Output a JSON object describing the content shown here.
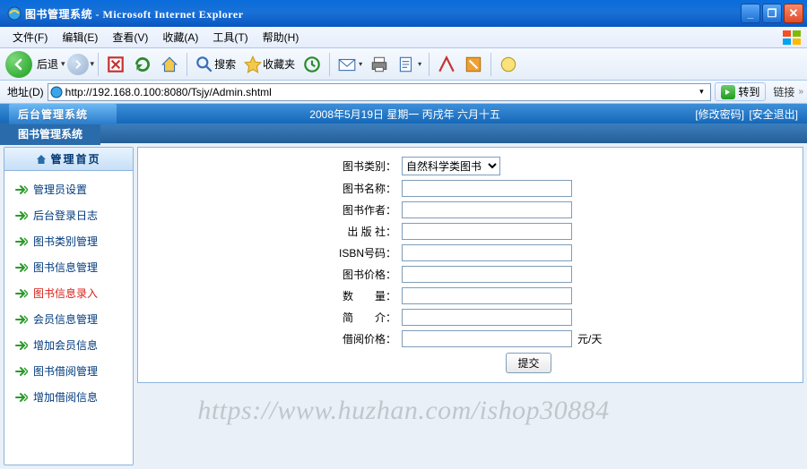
{
  "window": {
    "title": "图书管理系统 - Microsoft Internet Explorer"
  },
  "menu": {
    "items": [
      "文件(F)",
      "编辑(E)",
      "查看(V)",
      "收藏(A)",
      "工具(T)",
      "帮助(H)"
    ]
  },
  "toolbar": {
    "back": "后退",
    "search": "搜索",
    "favorites": "收藏夹"
  },
  "address": {
    "label": "地址(D)",
    "url": "http://192.168.0.100:8080/Tsjy/Admin.shtml",
    "go": "转到",
    "links": "链接"
  },
  "app": {
    "brand": "后台管理系统",
    "date": "2008年5月19日 星期一 丙戌年 六月十五",
    "change_pw": "[修改密码]",
    "logout": "[安全退出]",
    "subheader": "图书管理系统"
  },
  "sidebar": {
    "header": "管理首页",
    "items": [
      {
        "label": "管理员设置",
        "active": false
      },
      {
        "label": "后台登录日志",
        "active": false
      },
      {
        "label": "图书类别管理",
        "active": false
      },
      {
        "label": "图书信息管理",
        "active": false
      },
      {
        "label": "图书信息录入",
        "active": true
      },
      {
        "label": "会员信息管理",
        "active": false
      },
      {
        "label": "增加会员信息",
        "active": false
      },
      {
        "label": "图书借阅管理",
        "active": false
      },
      {
        "label": "增加借阅信息",
        "active": false
      }
    ]
  },
  "form": {
    "category_label": "图书类别：",
    "category_value": "自然科学类图书",
    "name_label": "图书名称：",
    "author_label": "图书作者：",
    "publisher_label": "出 版 社：",
    "isbn_label": "ISBN号码：",
    "price_label": "图书价格：",
    "qty_label": "数　　量：",
    "intro_label": "简　　介：",
    "rent_label": "借阅价格：",
    "rent_suffix": "元/天",
    "submit": "提交"
  },
  "watermark": "https://www.huzhan.com/ishop30884"
}
